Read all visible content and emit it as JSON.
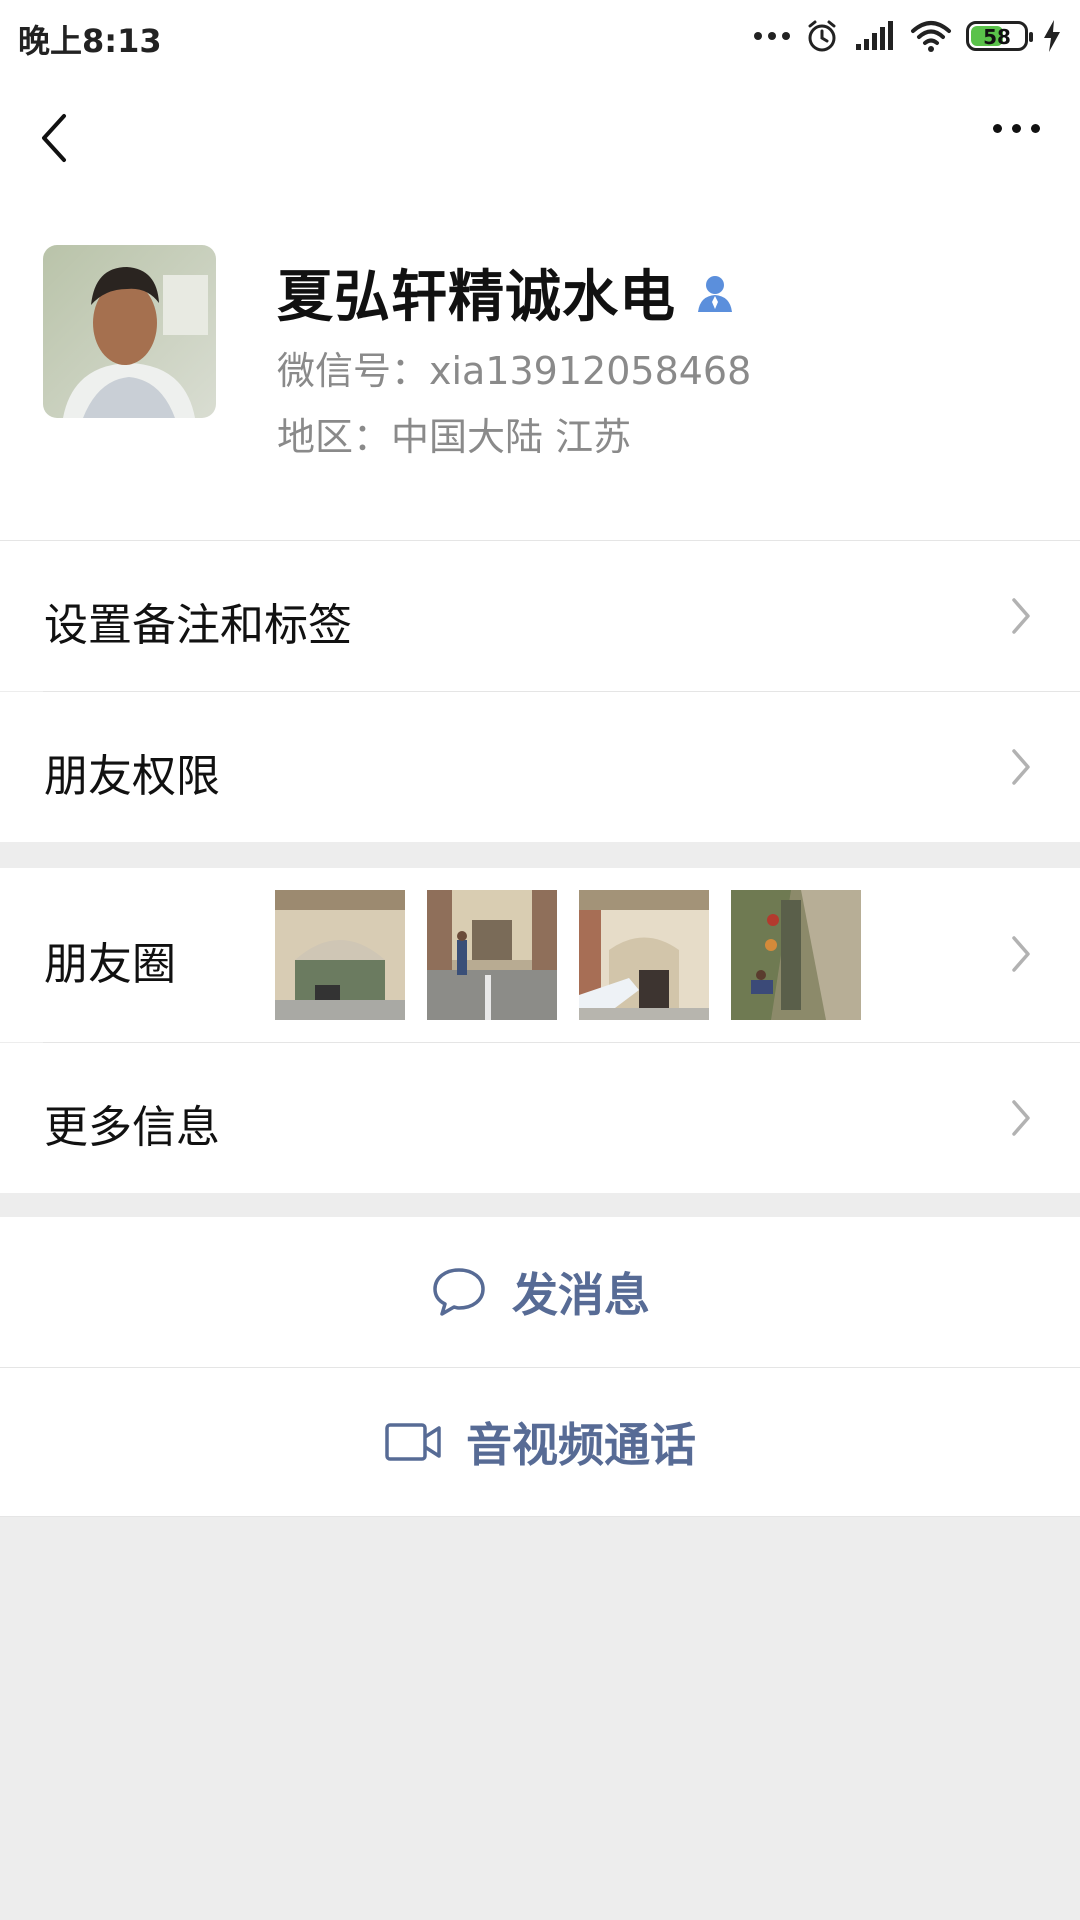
{
  "status_bar": {
    "time": "晚上8:13",
    "battery": "58",
    "icons": [
      "more-dots-icon",
      "alarm-icon",
      "signal-icon",
      "wifi-icon",
      "battery-icon",
      "charging-icon"
    ]
  },
  "nav": {
    "back_icon": "chevron-left-icon",
    "more_icon": "more-horizontal-icon"
  },
  "profile": {
    "name": "夏弘轩精诚水电",
    "badge_icon": "contact-person-icon",
    "wechat_id": "微信号：xia13912058468",
    "region": "地区：中国大陆  江苏"
  },
  "cells": {
    "remark_tags": "设置备注和标签",
    "friend_permissions": "朋友权限",
    "moments": "朋友圈",
    "more_info": "更多信息"
  },
  "actions": {
    "send_message": "发消息",
    "av_call": "音视频通话"
  },
  "colors": {
    "accent": "#576b95",
    "badge_blue": "#5b8fdc",
    "background": "#ededed",
    "battery_green": "#5ac24a"
  }
}
